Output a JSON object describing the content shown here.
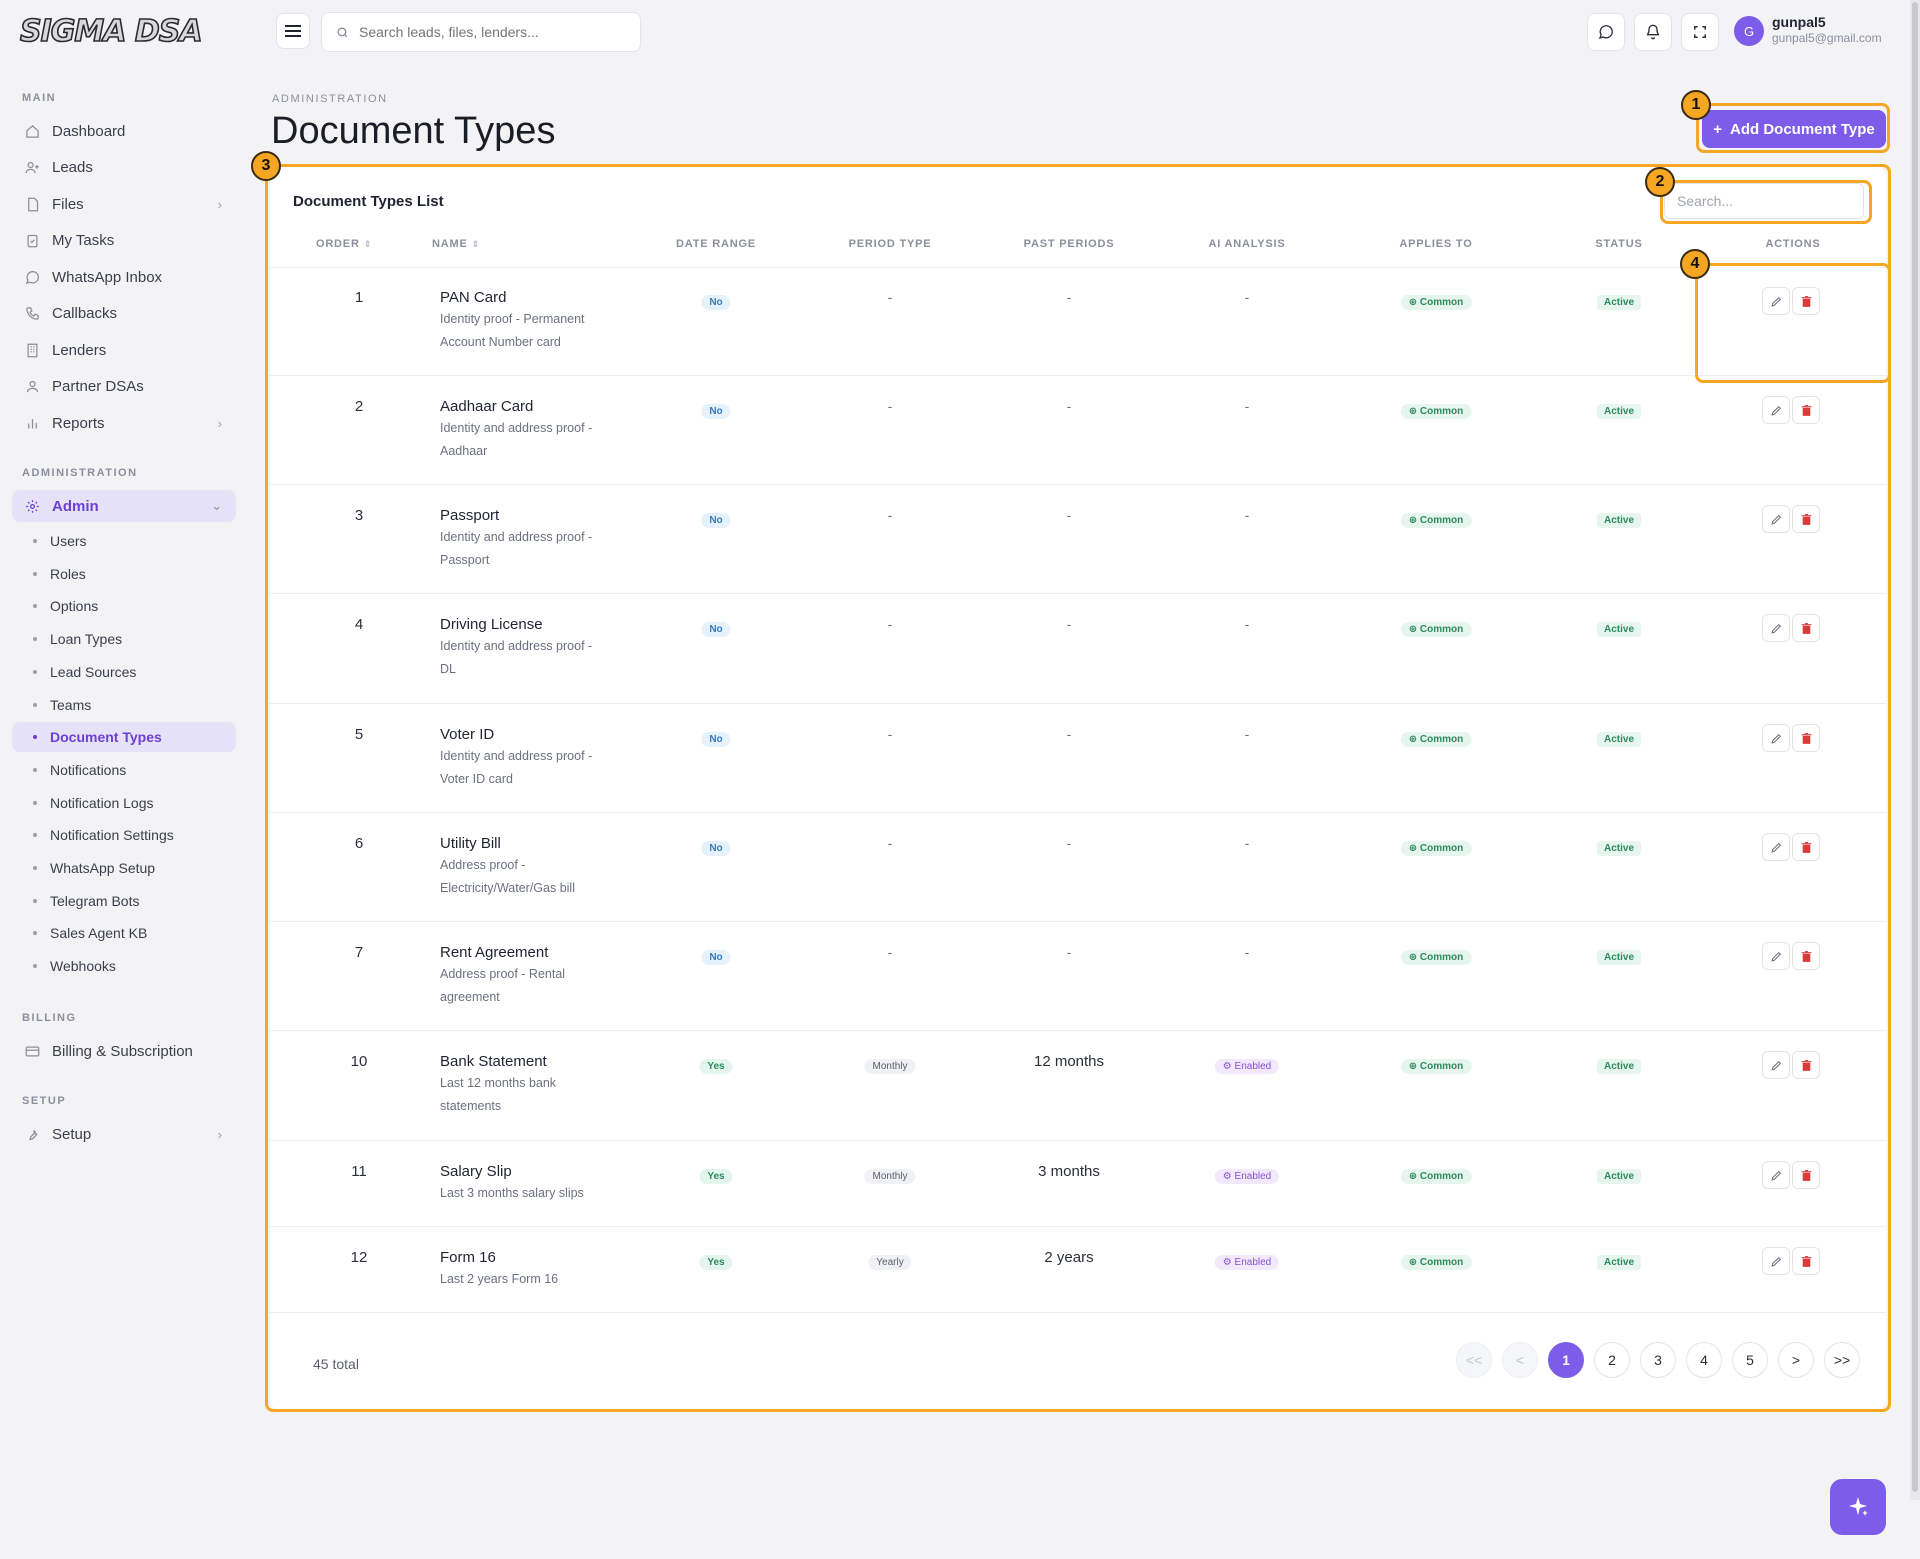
{
  "logo": "SIGMA DSA",
  "sidebar": {
    "section_main": "MAIN",
    "main_items": [
      {
        "label": "Dashboard",
        "icon": "home-icon"
      },
      {
        "label": "Leads",
        "icon": "user-plus-icon"
      },
      {
        "label": "Files",
        "icon": "file-icon",
        "has_children": true
      },
      {
        "label": "My Tasks",
        "icon": "clipboard-check-icon"
      },
      {
        "label": "WhatsApp Inbox",
        "icon": "whatsapp-icon"
      },
      {
        "label": "Callbacks",
        "icon": "phone-icon"
      },
      {
        "label": "Lenders",
        "icon": "building-icon"
      },
      {
        "label": "Partner DSAs",
        "icon": "user-icon"
      },
      {
        "label": "Reports",
        "icon": "bar-chart-icon",
        "has_children": true
      }
    ],
    "section_admin": "ADMINISTRATION",
    "admin_label": "Admin",
    "admin_items": [
      "Users",
      "Roles",
      "Options",
      "Loan Types",
      "Lead Sources",
      "Teams",
      "Document Types",
      "Notifications",
      "Notification Logs",
      "Notification Settings",
      "WhatsApp Setup",
      "Telegram Bots",
      "Sales Agent KB",
      "Webhooks"
    ],
    "active_admin_item": "Document Types",
    "section_billing": "BILLING",
    "billing_label": "Billing & Subscription",
    "section_setup": "SETUP",
    "setup_label": "Setup"
  },
  "topbar": {
    "search_placeholder": "Search leads, files, lenders...",
    "user_initial": "G",
    "user_name": "gunpal5",
    "user_email": "gunpal5@gmail.com"
  },
  "header": {
    "breadcrumb": "ADMINISTRATION",
    "title": "Document Types",
    "add_button": "Add Document Type"
  },
  "card": {
    "title": "Document Types List",
    "search_placeholder": "Search..."
  },
  "table": {
    "columns": [
      "ORDER",
      "NAME",
      "DATE RANGE",
      "PERIOD TYPE",
      "PAST PERIODS",
      "AI ANALYSIS",
      "APPLIES TO",
      "STATUS",
      "ACTIONS"
    ],
    "rows": [
      {
        "order": "1",
        "name": "PAN Card",
        "desc1": "Identity proof  -  Permanent",
        "desc2": "Account Number card",
        "date_range": "No",
        "period_type": "-",
        "past_periods": "-",
        "ai_analysis": "-",
        "applies_to": "Common",
        "status": "Active"
      },
      {
        "order": "2",
        "name": "Aadhaar Card",
        "desc1": "Identity and address proof  -",
        "desc2": "Aadhaar",
        "date_range": "No",
        "period_type": "-",
        "past_periods": "-",
        "ai_analysis": "-",
        "applies_to": "Common",
        "status": "Active"
      },
      {
        "order": "3",
        "name": "Passport",
        "desc1": "Identity and address proof  -",
        "desc2": "Passport",
        "date_range": "No",
        "period_type": "-",
        "past_periods": "-",
        "ai_analysis": "-",
        "applies_to": "Common",
        "status": "Active"
      },
      {
        "order": "4",
        "name": "Driving License",
        "desc1": "Identity and address proof  -",
        "desc2": "DL",
        "date_range": "No",
        "period_type": "-",
        "past_periods": "-",
        "ai_analysis": "-",
        "applies_to": "Common",
        "status": "Active"
      },
      {
        "order": "5",
        "name": "Voter ID",
        "desc1": "Identity and address proof  -",
        "desc2": "Voter ID card",
        "date_range": "No",
        "period_type": "-",
        "past_periods": "-",
        "ai_analysis": "-",
        "applies_to": "Common",
        "status": "Active"
      },
      {
        "order": "6",
        "name": "Utility Bill",
        "desc1": "Address proof  -",
        "desc2": "Electricity/Water/Gas bill",
        "date_range": "No",
        "period_type": "-",
        "past_periods": "-",
        "ai_analysis": "-",
        "applies_to": "Common",
        "status": "Active"
      },
      {
        "order": "7",
        "name": "Rent Agreement",
        "desc1": "Address proof  -  Rental",
        "desc2": "agreement",
        "date_range": "No",
        "period_type": "-",
        "past_periods": "-",
        "ai_analysis": "-",
        "applies_to": "Common",
        "status": "Active"
      },
      {
        "order": "10",
        "name": "Bank Statement",
        "desc1": "Last 12 months bank",
        "desc2": "statements",
        "date_range": "Yes",
        "period_type": "Monthly",
        "past_periods": "12 months",
        "ai_analysis": "Enabled",
        "applies_to": "Common",
        "status": "Active"
      },
      {
        "order": "11",
        "name": "Salary Slip",
        "desc1": "Last 3 months salary slips",
        "desc2": "",
        "date_range": "Yes",
        "period_type": "Monthly",
        "past_periods": "3 months",
        "ai_analysis": "Enabled",
        "applies_to": "Common",
        "status": "Active"
      },
      {
        "order": "12",
        "name": "Form 16",
        "desc1": "Last 2 years Form 16",
        "desc2": "",
        "date_range": "Yes",
        "period_type": "Yearly",
        "past_periods": "2 years",
        "ai_analysis": "Enabled",
        "applies_to": "Common",
        "status": "Active"
      }
    ]
  },
  "pagination": {
    "total": "45 total",
    "first": "<<",
    "prev": "<",
    "pages": [
      "1",
      "2",
      "3",
      "4",
      "5"
    ],
    "current": "1",
    "next": ">",
    "last": ">>"
  },
  "annotations": [
    "1",
    "2",
    "3",
    "4"
  ],
  "colors": {
    "accent": "#7c5ce8",
    "annotation": "#f5a623",
    "success": "#2f8a5e",
    "danger": "#d93a3a"
  }
}
